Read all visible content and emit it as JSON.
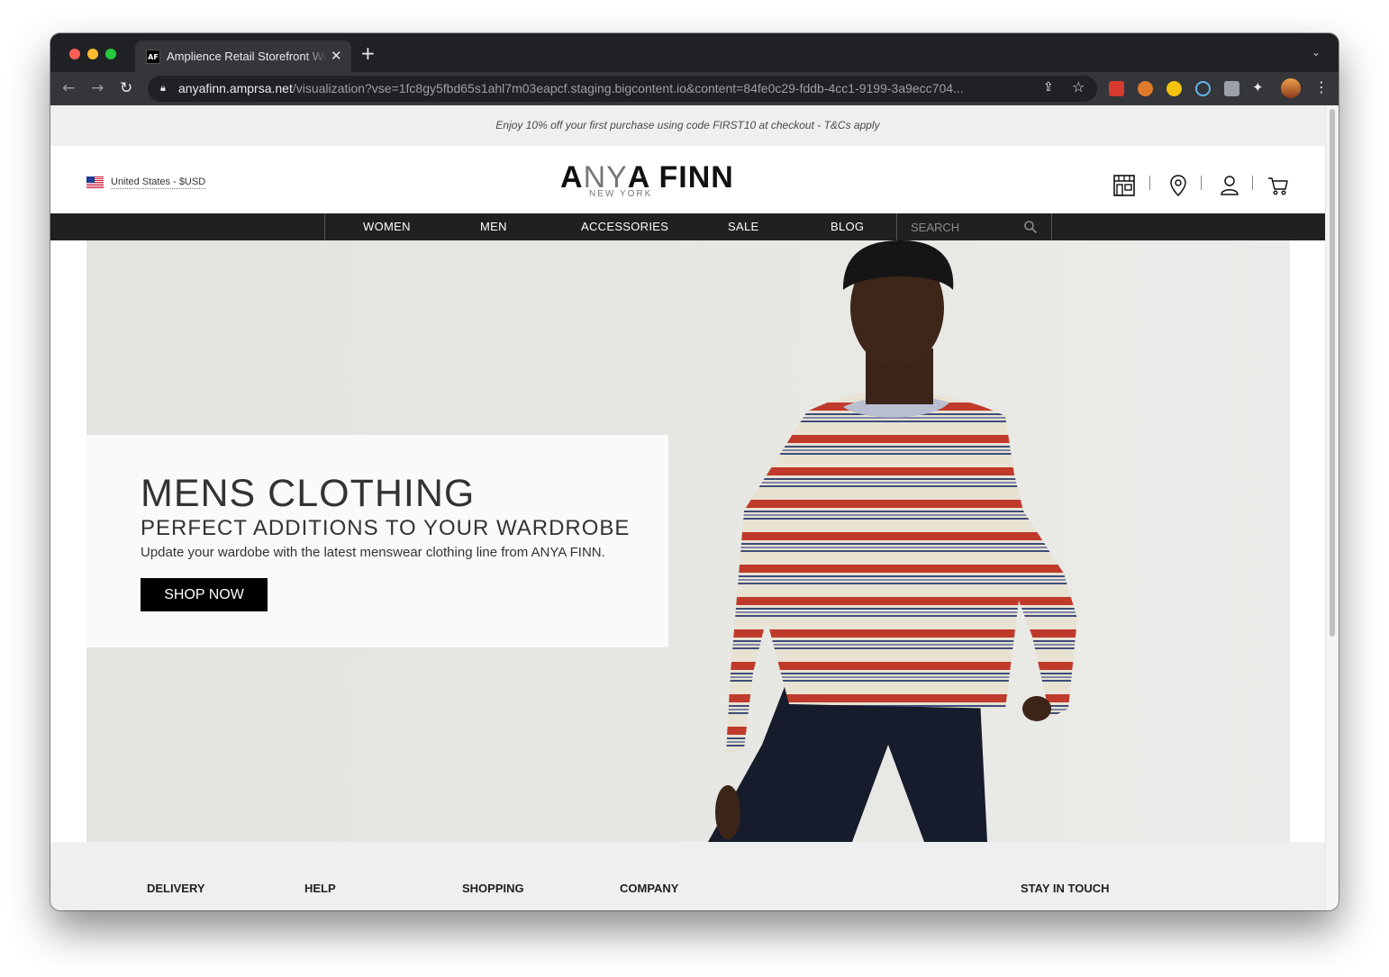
{
  "browser": {
    "tab_title": "Amplience Retail Storefront Web App",
    "tab_favicon_text": "AF",
    "url_host": "anyafinn.amprsa.net",
    "url_path": "/visualization?vse=1fc8gy5fbd65s1ahl7m03eapcf.staging.bigcontent.io&content=84fe0c29-fddb-4cc1-9199-3a9ecc704..."
  },
  "promo": {
    "text": "Enjoy 10% off your first purchase using code FIRST10 at checkout - T&Cs apply"
  },
  "header": {
    "locale": "United States - $USD",
    "logo": {
      "part1": "A",
      "part2": "NY",
      "part3": "A FINN",
      "sub": "NEW YORK"
    }
  },
  "nav": {
    "items": [
      {
        "label": "WOMEN"
      },
      {
        "label": "MEN"
      },
      {
        "label": "ACCESSORIES"
      },
      {
        "label": "SALE"
      },
      {
        "label": "BLOG"
      }
    ],
    "search_placeholder": "SEARCH"
  },
  "hero": {
    "title": "MENS CLOTHING",
    "subtitle": "PERFECT ADDITIONS TO YOUR WARDROBE",
    "description": "Update your wardobe with the latest menswear clothing line from ANYA FINN.",
    "button_label": "SHOP NOW"
  },
  "footer": {
    "columns": [
      "DELIVERY",
      "HELP",
      "SHOPPING",
      "COMPANY",
      "STAY IN TOUCH"
    ]
  },
  "colors": {
    "promo_bg": "#eeeff0",
    "nav_bg": "#202020",
    "hero_bg": "#e3e3df",
    "button_bg": "#000000"
  }
}
